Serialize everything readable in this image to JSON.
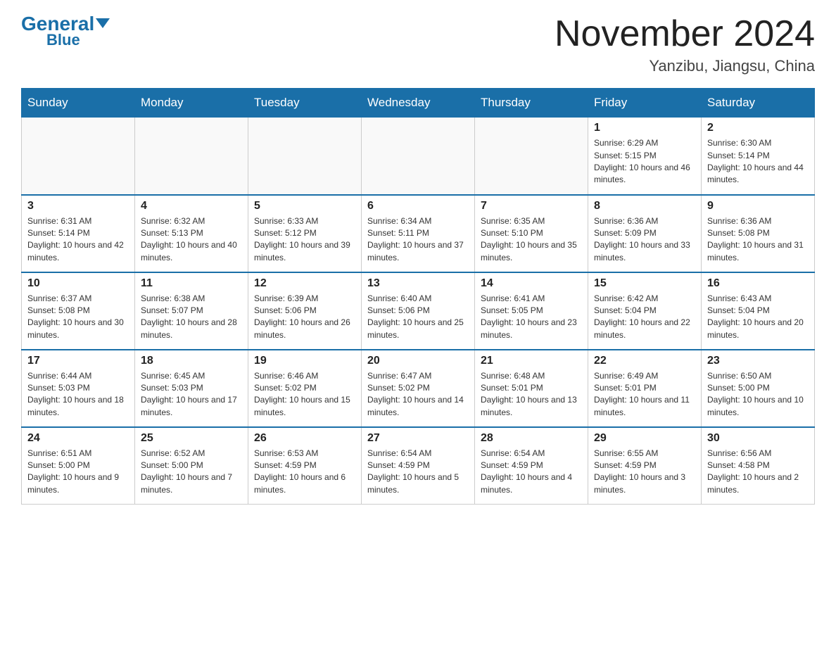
{
  "header": {
    "logo_general": "General",
    "logo_blue": "Blue",
    "main_title": "November 2024",
    "subtitle": "Yanzibu, Jiangsu, China"
  },
  "weekdays": [
    "Sunday",
    "Monday",
    "Tuesday",
    "Wednesday",
    "Thursday",
    "Friday",
    "Saturday"
  ],
  "weeks": [
    [
      {
        "day": "",
        "info": ""
      },
      {
        "day": "",
        "info": ""
      },
      {
        "day": "",
        "info": ""
      },
      {
        "day": "",
        "info": ""
      },
      {
        "day": "",
        "info": ""
      },
      {
        "day": "1",
        "info": "Sunrise: 6:29 AM\nSunset: 5:15 PM\nDaylight: 10 hours and 46 minutes."
      },
      {
        "day": "2",
        "info": "Sunrise: 6:30 AM\nSunset: 5:14 PM\nDaylight: 10 hours and 44 minutes."
      }
    ],
    [
      {
        "day": "3",
        "info": "Sunrise: 6:31 AM\nSunset: 5:14 PM\nDaylight: 10 hours and 42 minutes."
      },
      {
        "day": "4",
        "info": "Sunrise: 6:32 AM\nSunset: 5:13 PM\nDaylight: 10 hours and 40 minutes."
      },
      {
        "day": "5",
        "info": "Sunrise: 6:33 AM\nSunset: 5:12 PM\nDaylight: 10 hours and 39 minutes."
      },
      {
        "day": "6",
        "info": "Sunrise: 6:34 AM\nSunset: 5:11 PM\nDaylight: 10 hours and 37 minutes."
      },
      {
        "day": "7",
        "info": "Sunrise: 6:35 AM\nSunset: 5:10 PM\nDaylight: 10 hours and 35 minutes."
      },
      {
        "day": "8",
        "info": "Sunrise: 6:36 AM\nSunset: 5:09 PM\nDaylight: 10 hours and 33 minutes."
      },
      {
        "day": "9",
        "info": "Sunrise: 6:36 AM\nSunset: 5:08 PM\nDaylight: 10 hours and 31 minutes."
      }
    ],
    [
      {
        "day": "10",
        "info": "Sunrise: 6:37 AM\nSunset: 5:08 PM\nDaylight: 10 hours and 30 minutes."
      },
      {
        "day": "11",
        "info": "Sunrise: 6:38 AM\nSunset: 5:07 PM\nDaylight: 10 hours and 28 minutes."
      },
      {
        "day": "12",
        "info": "Sunrise: 6:39 AM\nSunset: 5:06 PM\nDaylight: 10 hours and 26 minutes."
      },
      {
        "day": "13",
        "info": "Sunrise: 6:40 AM\nSunset: 5:06 PM\nDaylight: 10 hours and 25 minutes."
      },
      {
        "day": "14",
        "info": "Sunrise: 6:41 AM\nSunset: 5:05 PM\nDaylight: 10 hours and 23 minutes."
      },
      {
        "day": "15",
        "info": "Sunrise: 6:42 AM\nSunset: 5:04 PM\nDaylight: 10 hours and 22 minutes."
      },
      {
        "day": "16",
        "info": "Sunrise: 6:43 AM\nSunset: 5:04 PM\nDaylight: 10 hours and 20 minutes."
      }
    ],
    [
      {
        "day": "17",
        "info": "Sunrise: 6:44 AM\nSunset: 5:03 PM\nDaylight: 10 hours and 18 minutes."
      },
      {
        "day": "18",
        "info": "Sunrise: 6:45 AM\nSunset: 5:03 PM\nDaylight: 10 hours and 17 minutes."
      },
      {
        "day": "19",
        "info": "Sunrise: 6:46 AM\nSunset: 5:02 PM\nDaylight: 10 hours and 15 minutes."
      },
      {
        "day": "20",
        "info": "Sunrise: 6:47 AM\nSunset: 5:02 PM\nDaylight: 10 hours and 14 minutes."
      },
      {
        "day": "21",
        "info": "Sunrise: 6:48 AM\nSunset: 5:01 PM\nDaylight: 10 hours and 13 minutes."
      },
      {
        "day": "22",
        "info": "Sunrise: 6:49 AM\nSunset: 5:01 PM\nDaylight: 10 hours and 11 minutes."
      },
      {
        "day": "23",
        "info": "Sunrise: 6:50 AM\nSunset: 5:00 PM\nDaylight: 10 hours and 10 minutes."
      }
    ],
    [
      {
        "day": "24",
        "info": "Sunrise: 6:51 AM\nSunset: 5:00 PM\nDaylight: 10 hours and 9 minutes."
      },
      {
        "day": "25",
        "info": "Sunrise: 6:52 AM\nSunset: 5:00 PM\nDaylight: 10 hours and 7 minutes."
      },
      {
        "day": "26",
        "info": "Sunrise: 6:53 AM\nSunset: 4:59 PM\nDaylight: 10 hours and 6 minutes."
      },
      {
        "day": "27",
        "info": "Sunrise: 6:54 AM\nSunset: 4:59 PM\nDaylight: 10 hours and 5 minutes."
      },
      {
        "day": "28",
        "info": "Sunrise: 6:54 AM\nSunset: 4:59 PM\nDaylight: 10 hours and 4 minutes."
      },
      {
        "day": "29",
        "info": "Sunrise: 6:55 AM\nSunset: 4:59 PM\nDaylight: 10 hours and 3 minutes."
      },
      {
        "day": "30",
        "info": "Sunrise: 6:56 AM\nSunset: 4:58 PM\nDaylight: 10 hours and 2 minutes."
      }
    ]
  ]
}
